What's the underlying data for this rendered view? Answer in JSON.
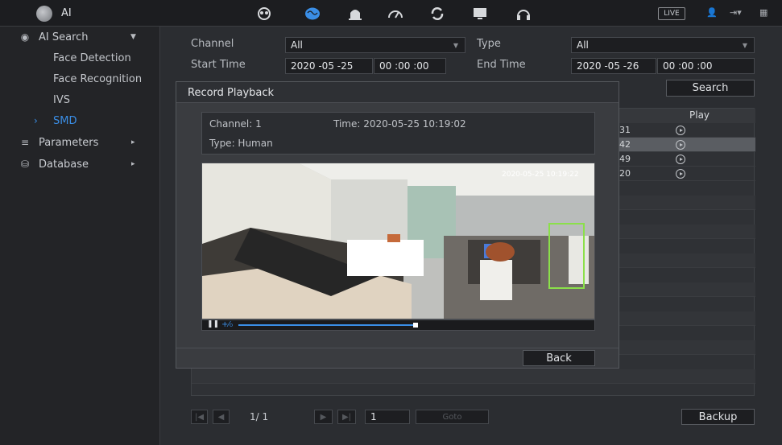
{
  "topbar": {
    "title": "AI",
    "live_label": "LIVE",
    "icons": [
      "smd-icon",
      "ai-brain-icon",
      "alarm-icon",
      "gauge-icon",
      "refresh-icon",
      "monitor-icon",
      "headset-icon"
    ],
    "active_icon": "ai-brain-icon"
  },
  "sidebar": {
    "ai_search": "AI Search",
    "items": [
      {
        "label": "Face Detection"
      },
      {
        "label": "Face Recognition"
      },
      {
        "label": "IVS"
      },
      {
        "label": "SMD"
      }
    ],
    "parameters": "Parameters",
    "database": "Database"
  },
  "search_form": {
    "channel_label": "Channel",
    "channel_value": "All",
    "type_label": "Type",
    "type_value": "All",
    "start_label": "Start Time",
    "start_date": "2020 -05 -25",
    "start_time": "00 :00 :00",
    "end_label": "End Time",
    "end_date": "2020 -05 -26",
    "end_time": "00 :00 :00",
    "search_button": "Search"
  },
  "table": {
    "play_header": "Play",
    "rows": [
      {
        "num": "31"
      },
      {
        "num": "42"
      },
      {
        "num": "49"
      },
      {
        "num": "20"
      }
    ]
  },
  "pager": {
    "page": "1/ 1",
    "goto_value": "1",
    "goto_label": "Goto",
    "backup_button": "Backup"
  },
  "modal": {
    "title": "Record Playback",
    "channel": "Channel: 1",
    "time": "Time: 2020-05-25 10:19:02",
    "type": "Type: Human",
    "osd_time": "2020-05-25 10:19:22",
    "back_button": "Back",
    "progress_fraction": 0.55
  },
  "colors": {
    "accent": "#3a8ee6",
    "detect_box": "#8be04a"
  }
}
